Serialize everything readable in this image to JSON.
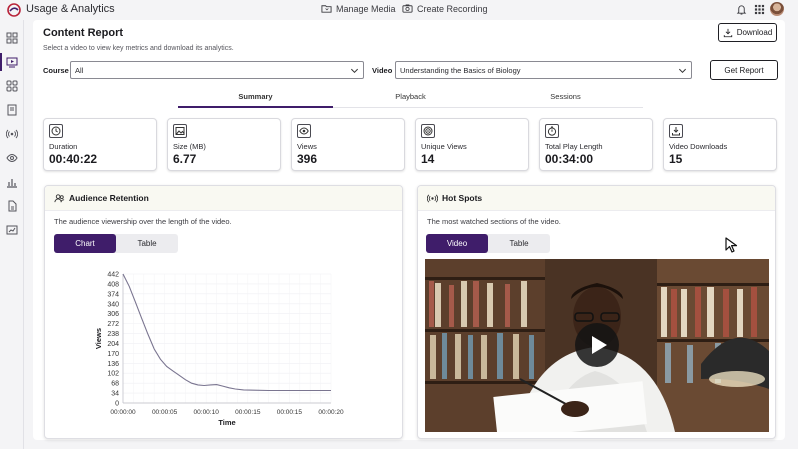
{
  "app": {
    "title": "Usage & Analytics"
  },
  "topbar": {
    "manage_media": "Manage Media",
    "create_recording": "Create Recording"
  },
  "header": {
    "title": "Content Report",
    "subtitle": "Select a video to view key metrics and download its analytics.",
    "download_label": "Download"
  },
  "filters": {
    "course_label": "Course",
    "course_value": "All",
    "video_label": "Video",
    "video_value": "Understanding the Basics of Biology",
    "get_report_label": "Get Report"
  },
  "tabs": [
    {
      "label": "Summary",
      "active": true
    },
    {
      "label": "Playback",
      "active": false
    },
    {
      "label": "Sessions",
      "active": false
    }
  ],
  "stats": [
    {
      "label": "Duration",
      "value": "00:40:22",
      "icon": "clock-icon"
    },
    {
      "label": "Size (MB)",
      "value": "6.77",
      "icon": "image-icon"
    },
    {
      "label": "Views",
      "value": "396",
      "icon": "eye-icon"
    },
    {
      "label": "Unique Views",
      "value": "14",
      "icon": "target-icon"
    },
    {
      "label": "Total Play Length",
      "value": "00:34:00",
      "icon": "stopwatch-icon"
    },
    {
      "label": "Video Downloads",
      "value": "15",
      "icon": "download-icon"
    }
  ],
  "retention": {
    "title": "Audience Retention",
    "description": "The audience viewership over the length of the video.",
    "chart_tab": "Chart",
    "table_tab": "Table"
  },
  "hotspots": {
    "title": "Hot Spots",
    "description": "The most watched sections of the video.",
    "video_tab": "Video",
    "table_tab": "Table"
  },
  "chart_data": {
    "type": "line",
    "title": "",
    "xlabel": "Time",
    "ylabel": "Views",
    "y_ticks": [
      "442",
      "408",
      "374",
      "340",
      "306",
      "272",
      "238",
      "204",
      "170",
      "136",
      "102",
      "68",
      "34",
      "0"
    ],
    "x_ticks": [
      "00:00:00",
      "00:00:05",
      "00:00:10",
      "00:00:15",
      "00:00:15",
      "00:00:20"
    ],
    "ylim": [
      0,
      442
    ],
    "series": [
      {
        "color": "#7a7590",
        "points": [
          [
            0,
            442
          ],
          [
            0.6,
            400
          ],
          [
            1.2,
            345
          ],
          [
            1.8,
            290
          ],
          [
            2.4,
            235
          ],
          [
            3.0,
            185
          ],
          [
            3.6,
            150
          ],
          [
            4.2,
            125
          ],
          [
            4.8,
            110
          ],
          [
            5.4,
            95
          ],
          [
            6.0,
            80
          ],
          [
            6.6,
            68
          ],
          [
            7.2,
            62
          ],
          [
            7.8,
            60
          ],
          [
            8.4,
            62
          ],
          [
            9.0,
            63
          ],
          [
            9.6,
            58
          ],
          [
            10.2,
            52
          ],
          [
            10.8,
            48
          ],
          [
            11.6,
            45
          ],
          [
            12.6,
            44
          ],
          [
            14.0,
            43
          ],
          [
            16.0,
            43
          ],
          [
            18.0,
            43
          ],
          [
            20.0,
            43
          ]
        ]
      }
    ],
    "grid": true
  },
  "colors": {
    "accent": "#3f1d6a",
    "line": "#7a7590"
  }
}
